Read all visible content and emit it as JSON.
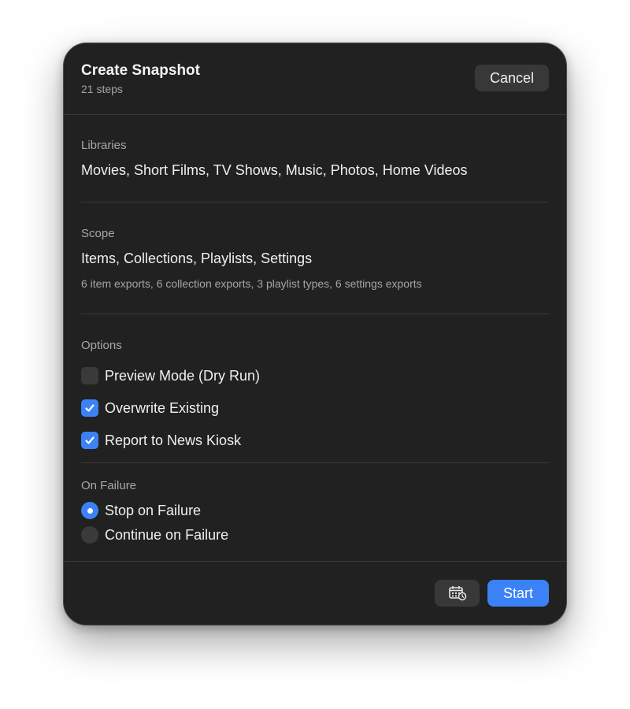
{
  "header": {
    "title": "Create Snapshot",
    "subtitle": "21 steps",
    "cancel_label": "Cancel"
  },
  "libraries": {
    "label": "Libraries",
    "value": "Movies, Short Films, TV Shows, Music, Photos, Home Videos"
  },
  "scope": {
    "label": "Scope",
    "value": "Items, Collections, Playlists, Settings",
    "detail": "6 item exports, 6 collection exports, 3 playlist types, 6 settings exports"
  },
  "options": {
    "label": "Options",
    "items": [
      {
        "label": "Preview Mode (Dry Run)",
        "checked": false
      },
      {
        "label": "Overwrite Existing",
        "checked": true
      },
      {
        "label": "Report to News Kiosk",
        "checked": true
      }
    ]
  },
  "on_failure": {
    "label": "On Failure",
    "choices": [
      {
        "label": "Stop on Failure",
        "selected": true
      },
      {
        "label": "Continue on Failure",
        "selected": false
      }
    ]
  },
  "footer": {
    "schedule_icon": "calendar-clock-icon",
    "start_label": "Start"
  },
  "colors": {
    "accent": "#3b82f6",
    "background": "#212121"
  }
}
